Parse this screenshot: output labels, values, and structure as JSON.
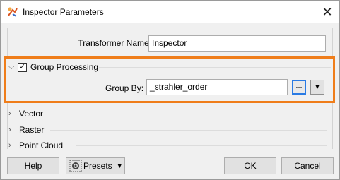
{
  "window": {
    "title": "Inspector Parameters",
    "close_glyph": "✕"
  },
  "transformer": {
    "label": "Transformer Name:",
    "value": "Inspector"
  },
  "group_processing": {
    "label": "Group Processing",
    "checked": true,
    "check_glyph": "✓",
    "group_by_label": "Group By:",
    "group_by_value": "_strahler_order",
    "ellipsis_label": "...",
    "dropdown_glyph": "▼",
    "highlight_color": "#ef7d1a"
  },
  "sections": [
    {
      "label": "Vector",
      "expanded": false
    },
    {
      "label": "Raster",
      "expanded": false
    },
    {
      "label": "Point Cloud",
      "expanded": false
    }
  ],
  "buttons": {
    "help": "Help",
    "presets": "Presets",
    "presets_caret": "▼",
    "ok": "OK",
    "cancel": "Cancel"
  },
  "icons": {
    "expanded": "chevron-down-icon",
    "collapsed": "chevron-right-icon",
    "app": "fme-transformer-icon",
    "presets": "gear-icon"
  }
}
